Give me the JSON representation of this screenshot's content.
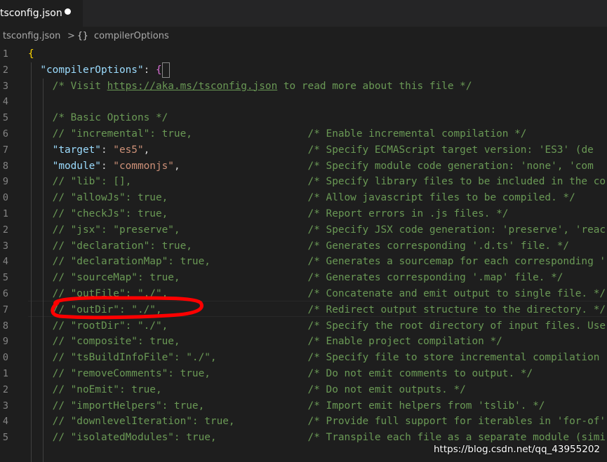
{
  "tab": {
    "filename": "tsconfig.json",
    "modified_dot": "unsaved-dot-icon"
  },
  "breadcrumb": {
    "file": "tsconfig.json",
    "separator": ">",
    "braces_icon": "{}",
    "object": "compilerOptions"
  },
  "line_numbers": [
    "1",
    "2",
    "3",
    "4",
    "5",
    "6",
    "7",
    "8",
    "9",
    "0",
    "1",
    "2",
    "3",
    "4",
    "5",
    "6",
    "7",
    "8",
    "9",
    "0",
    "1",
    "2",
    "3",
    "4",
    "5"
  ],
  "code_lines": [
    [
      {
        "t": "punc",
        "v": "{"
      }
    ],
    [
      {
        "t": "punc",
        "v": "  "
      },
      {
        "t": "key",
        "v": "\"compilerOptions\""
      },
      {
        "t": "punc",
        "v": ": "
      },
      {
        "t": "punc",
        "v": "{"
      }
    ],
    [
      {
        "t": "cmt",
        "v": "    /* Visit "
      },
      {
        "t": "link",
        "v": "https://aka.ms/tsconfig.json"
      },
      {
        "t": "cmt",
        "v": " to read more about this file */"
      }
    ],
    [],
    [
      {
        "t": "cmt",
        "v": "    /* Basic Options */"
      }
    ],
    [
      {
        "t": "cmt",
        "v": "    // \"incremental\": true,                   /* Enable incremental compilation */"
      }
    ],
    [
      {
        "t": "punc",
        "v": "    "
      },
      {
        "t": "key",
        "v": "\"target\""
      },
      {
        "t": "punc",
        "v": ": "
      },
      {
        "t": "str",
        "v": "\"es5\""
      },
      {
        "t": "punc",
        "v": ",                          "
      },
      {
        "t": "cmt",
        "v": "/* Specify ECMAScript target version: 'ES3' (de"
      }
    ],
    [
      {
        "t": "punc",
        "v": "    "
      },
      {
        "t": "key",
        "v": "\"module\""
      },
      {
        "t": "punc",
        "v": ": "
      },
      {
        "t": "str",
        "v": "\"commonjs\""
      },
      {
        "t": "punc",
        "v": ",                     "
      },
      {
        "t": "cmt",
        "v": "/* Specify module code generation: 'none', 'com"
      }
    ],
    [
      {
        "t": "cmt",
        "v": "    // \"lib\": [],                             /* Specify library files to be included in the co"
      }
    ],
    [
      {
        "t": "cmt",
        "v": "    // \"allowJs\": true,                       /* Allow javascript files to be compiled. */"
      }
    ],
    [
      {
        "t": "cmt",
        "v": "    // \"checkJs\": true,                       /* Report errors in .js files. */"
      }
    ],
    [
      {
        "t": "cmt",
        "v": "    // \"jsx\": \"preserve\",                     /* Specify JSX code generation: 'preserve', 'reac"
      }
    ],
    [
      {
        "t": "cmt",
        "v": "    // \"declaration\": true,                   /* Generates corresponding '.d.ts' file. */"
      }
    ],
    [
      {
        "t": "cmt",
        "v": "    // \"declarationMap\": true,                /* Generates a sourcemap for each corresponding '"
      }
    ],
    [
      {
        "t": "cmt",
        "v": "    // \"sourceMap\": true,                     /* Generates corresponding '.map' file. */"
      }
    ],
    [
      {
        "t": "cmt",
        "v": "    // \"outFile\": \"./\",                       /* Concatenate and emit output to single file. */"
      }
    ],
    [
      {
        "t": "cmt",
        "v": "    // \"outDir\": \"./\",                        /* Redirect output structure to the directory. */"
      }
    ],
    [
      {
        "t": "cmt",
        "v": "    // \"rootDir\": \"./\",                       /* Specify the root directory of input files. Use"
      }
    ],
    [
      {
        "t": "cmt",
        "v": "    // \"composite\": true,                     /* Enable project compilation */"
      }
    ],
    [
      {
        "t": "cmt",
        "v": "    // \"tsBuildInfoFile\": \"./\",               /* Specify file to store incremental compilation "
      }
    ],
    [
      {
        "t": "cmt",
        "v": "    // \"removeComments\": true,                /* Do not emit comments to output. */"
      }
    ],
    [
      {
        "t": "cmt",
        "v": "    // \"noEmit\": true,                        /* Do not emit outputs. */"
      }
    ],
    [
      {
        "t": "cmt",
        "v": "    // \"importHelpers\": true,                 /* Import emit helpers from 'tslib'. */"
      }
    ],
    [
      {
        "t": "cmt",
        "v": "    // \"downlevelIteration\": true,            /* Provide full support for iterables in 'for-of'"
      }
    ],
    [
      {
        "t": "cmt",
        "v": "    // \"isolatedModules\": true,               /* Transpile each file as a separate module (simi"
      }
    ]
  ],
  "watermark": "https://blog.csdn.net/qq_43955202",
  "colors": {
    "background": "#1e1e1e",
    "comment": "#6a9955",
    "key": "#9cdcfe",
    "string": "#ce9178",
    "annotation_red": "#ff0000"
  }
}
